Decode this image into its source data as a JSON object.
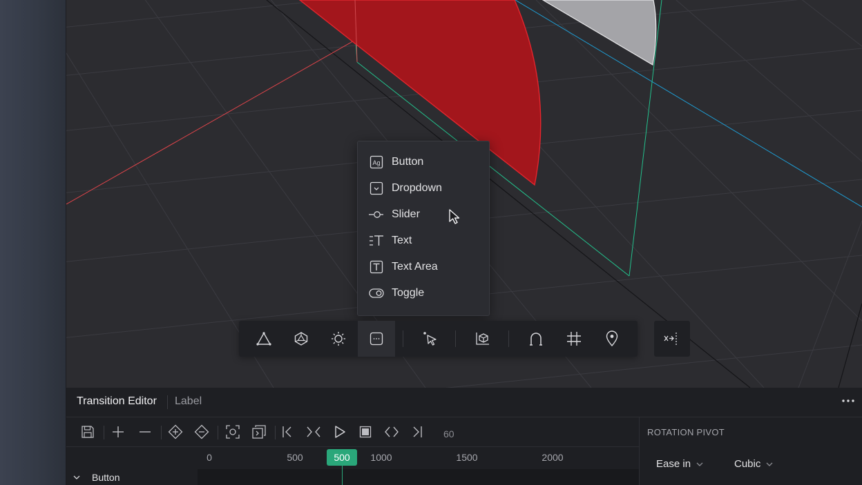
{
  "menu": {
    "items": [
      {
        "label": "Button",
        "icon": "button-component-icon"
      },
      {
        "label": "Dropdown",
        "icon": "dropdown-component-icon"
      },
      {
        "label": "Slider",
        "icon": "slider-component-icon"
      },
      {
        "label": "Text",
        "icon": "text-component-icon"
      },
      {
        "label": "Text Area",
        "icon": "text-area-component-icon"
      },
      {
        "label": "Toggle",
        "icon": "toggle-component-icon"
      }
    ]
  },
  "toolbar": {
    "tools": [
      "shape-triangle-icon",
      "polyhedron-icon",
      "light-sun-icon",
      "components-icon",
      "select-pointer-icon",
      "transform-box-icon",
      "magnet-snap-icon",
      "grid-icon",
      "location-pin-icon"
    ],
    "active": "components-icon",
    "extra": "collapse-panel-icon"
  },
  "panel": {
    "tabs": {
      "active": "Transition Editor",
      "other": "Label"
    },
    "fps": "60",
    "ruler": {
      "ticks": [
        "0",
        "500",
        "1000",
        "1500",
        "2000"
      ],
      "playhead": "500"
    },
    "track": {
      "name": "Button"
    },
    "right": {
      "title": "ROTATION PIVOT",
      "easing": "Ease in",
      "curve": "Cubic"
    }
  },
  "colors": {
    "accent": "#2aa77a",
    "red_shape": "#a3161c",
    "axis_x": "#e0444a",
    "axis_y": "#23c28d",
    "axis_z": "#1e9fd6"
  }
}
